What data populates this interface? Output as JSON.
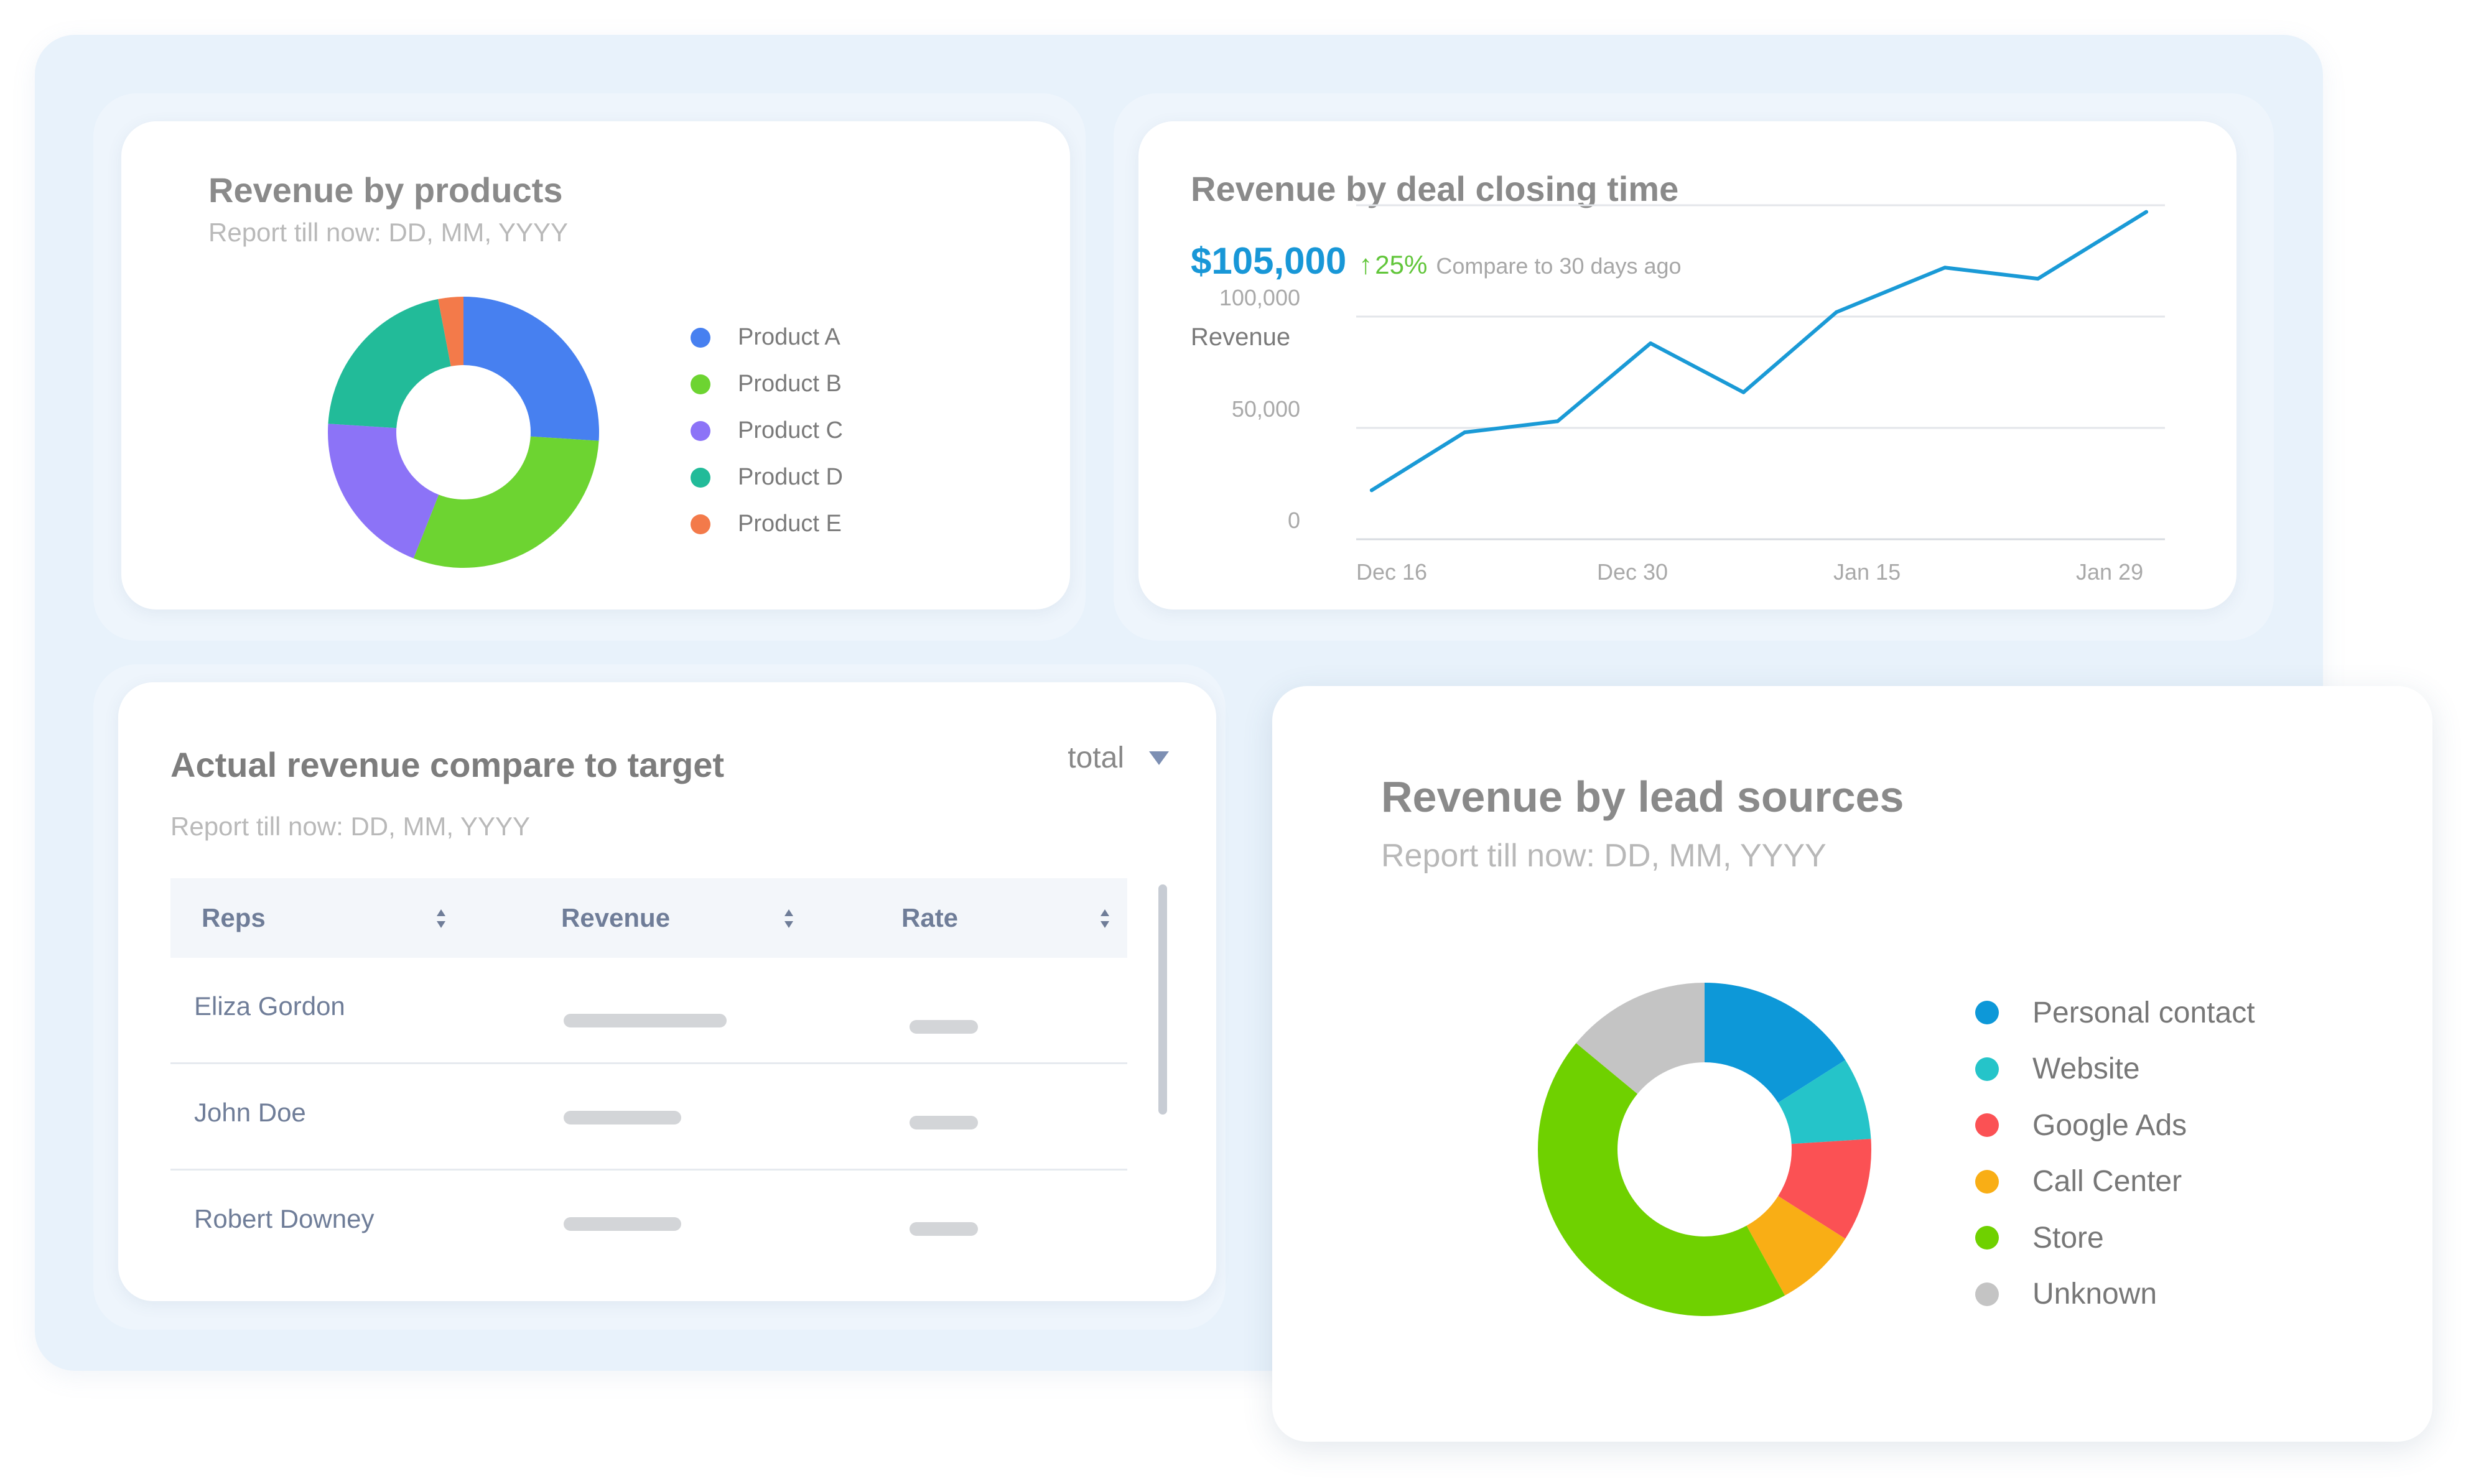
{
  "revenue_by_products": {
    "title": "Revenue by products",
    "subtitle": "Report till now: DD, MM, YYYY",
    "chart_data": {
      "type": "pie",
      "donut": true,
      "slices": [
        {
          "label": "Product A",
          "value": 26,
          "color": "#4780f0"
        },
        {
          "label": "Product B",
          "value": 30,
          "color": "#6dd431"
        },
        {
          "label": "Product C",
          "value": 20,
          "color": "#8c73f7"
        },
        {
          "label": "Product D",
          "value": 21,
          "color": "#22bb99"
        },
        {
          "label": "Product E",
          "value": 3,
          "color": "#f37a4a"
        }
      ],
      "legend": "right"
    }
  },
  "revenue_by_deal_closing_time": {
    "title": "Revenue by deal closing time",
    "kpi": {
      "value": "$105,000",
      "arrow": "↑",
      "change": "25%",
      "note": "Compare to 30 days ago"
    },
    "chart_data": {
      "type": "line",
      "ylabel": "Revenue",
      "ylim": [
        0,
        150000
      ],
      "yticks": [
        {
          "label": "0",
          "value": 0
        },
        {
          "label": "50,000",
          "value": 50000
        },
        {
          "label": "100,000",
          "value": 100000
        }
      ],
      "xticks": [
        "Dec 16",
        "Dec 30",
        "Jan 15",
        "Jan 29"
      ],
      "series": [
        {
          "color": "#1a9ad6",
          "x": [
            "Dec 17",
            "Dec 23",
            "Dec 29",
            "Jan 4",
            "Jan 10",
            "Jan 16",
            "Jan 23",
            "Jan 29",
            "Feb 5"
          ],
          "values": [
            22000,
            48000,
            53000,
            88000,
            66000,
            102000,
            122000,
            117000,
            147000
          ]
        }
      ],
      "grid": true
    }
  },
  "actual_vs_target": {
    "title": "Actual revenue compare to target",
    "subtitle": "Report till now: DD, MM, YYYY",
    "filter": {
      "selected": "total",
      "icon": "caret-down-icon"
    },
    "columns": [
      "Reps",
      "Revenue",
      "Rate"
    ],
    "rows": [
      {
        "rep": "Eliza Gordon",
        "revenue_fill": 1.0,
        "rate_fill": 1.0
      },
      {
        "rep": "John Doe",
        "revenue_fill": 0.72,
        "rate_fill": 1.0
      },
      {
        "rep": "Robert Downey",
        "revenue_fill": 0.72,
        "rate_fill": 1.0
      }
    ]
  },
  "revenue_by_lead_sources": {
    "title": "Revenue by lead sources",
    "subtitle": "Report till now: DD, MM, YYYY",
    "chart_data": {
      "type": "pie",
      "donut": true,
      "slices": [
        {
          "label": "Personal contact",
          "value": 16,
          "color": "#0d98d8"
        },
        {
          "label": "Website",
          "value": 8,
          "color": "#25c4c9"
        },
        {
          "label": "Google Ads",
          "value": 10,
          "color": "#fb5154"
        },
        {
          "label": "Call Center",
          "value": 8,
          "color": "#f9ae15"
        },
        {
          "label": "Store",
          "value": 44,
          "color": "#6fd100"
        },
        {
          "label": "Unknown",
          "value": 14,
          "color": "#c4c4c4"
        }
      ],
      "legend": "right"
    }
  }
}
